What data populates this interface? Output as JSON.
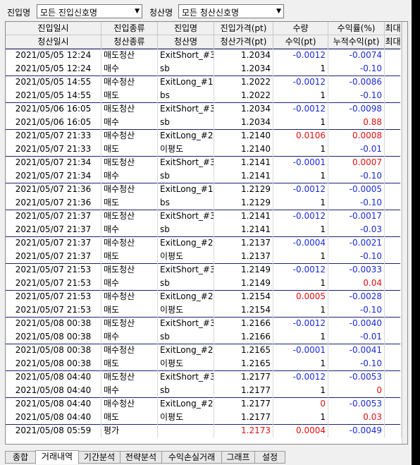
{
  "filters": {
    "entry_label": "진입명",
    "entry_value": "모든 진입신호명",
    "exit_label": "청산명",
    "exit_value": "모든 청산신호명"
  },
  "header": {
    "row1": [
      "진입일시",
      "진입종류",
      "진입명",
      "진입가격(pt)",
      "수량",
      "수익률(%)",
      "최대"
    ],
    "row2": [
      "청산일시",
      "청산종류",
      "청산명",
      "청산가격(pt)",
      "수익(pt)",
      "누적수익(pt)",
      "최대"
    ]
  },
  "rows": [
    {
      "d": "2021/05/05 12:24",
      "t": "매도청산",
      "n": "ExitShort_#3",
      "p": "1.2034",
      "q": "-0.0012",
      "r": "-0.0074",
      "qc": "blue",
      "rc": "blue",
      "entry": true
    },
    {
      "d": "2021/05/05 12:24",
      "t": "매수",
      "n": "sb",
      "p": "1.2034",
      "q": "1",
      "r": "-0.10",
      "qc": "",
      "rc": "blue",
      "entry": false
    },
    {
      "d": "2021/05/05 14:55",
      "t": "매수청산",
      "n": "ExitLong_#1",
      "p": "1.2022",
      "q": "-0.0012",
      "r": "-0.0086",
      "qc": "blue",
      "rc": "blue",
      "entry": true
    },
    {
      "d": "2021/05/05 14:55",
      "t": "매도",
      "n": "bs",
      "p": "1.2022",
      "q": "1",
      "r": "-0.10",
      "qc": "",
      "rc": "blue",
      "entry": false
    },
    {
      "d": "2021/05/06 16:05",
      "t": "매도청산",
      "n": "ExitShort_#3",
      "p": "1.2034",
      "q": "-0.0012",
      "r": "-0.0098",
      "qc": "blue",
      "rc": "blue",
      "entry": true
    },
    {
      "d": "2021/05/06 16:05",
      "t": "매수",
      "n": "sb",
      "p": "1.2034",
      "q": "1",
      "r": "0.88",
      "qc": "",
      "rc": "red",
      "entry": false
    },
    {
      "d": "2021/05/07 21:33",
      "t": "매수청산",
      "n": "ExitLong_#2",
      "p": "1.2140",
      "q": "0.0106",
      "r": "0.0008",
      "qc": "red",
      "rc": "red",
      "entry": true
    },
    {
      "d": "2021/05/07 21:33",
      "t": "매도",
      "n": "이평도",
      "p": "1.2140",
      "q": "1",
      "r": "-0.01",
      "qc": "",
      "rc": "blue",
      "entry": false
    },
    {
      "d": "2021/05/07 21:34",
      "t": "매도청산",
      "n": "ExitShort_#3",
      "p": "1.2141",
      "q": "-0.0001",
      "r": "0.0007",
      "qc": "blue",
      "rc": "red",
      "entry": true
    },
    {
      "d": "2021/05/07 21:34",
      "t": "매수",
      "n": "sb",
      "p": "1.2141",
      "q": "1",
      "r": "-0.10",
      "qc": "",
      "rc": "blue",
      "entry": false
    },
    {
      "d": "2021/05/07 21:36",
      "t": "매수청산",
      "n": "ExitLong_#1",
      "p": "1.2129",
      "q": "-0.0012",
      "r": "-0.0005",
      "qc": "blue",
      "rc": "blue",
      "entry": true
    },
    {
      "d": "2021/05/07 21:36",
      "t": "매도",
      "n": "bs",
      "p": "1.2129",
      "q": "1",
      "r": "-0.10",
      "qc": "",
      "rc": "blue",
      "entry": false
    },
    {
      "d": "2021/05/07 21:37",
      "t": "매도청산",
      "n": "ExitShort_#3",
      "p": "1.2141",
      "q": "-0.0012",
      "r": "-0.0017",
      "qc": "blue",
      "rc": "blue",
      "entry": true
    },
    {
      "d": "2021/05/07 21:37",
      "t": "매수",
      "n": "sb",
      "p": "1.2141",
      "q": "1",
      "r": "-0.03",
      "qc": "",
      "rc": "blue",
      "entry": false
    },
    {
      "d": "2021/05/07 21:37",
      "t": "매수청산",
      "n": "ExitLong_#2",
      "p": "1.2137",
      "q": "-0.0004",
      "r": "-0.0021",
      "qc": "blue",
      "rc": "blue",
      "entry": true
    },
    {
      "d": "2021/05/07 21:37",
      "t": "매도",
      "n": "이평도",
      "p": "1.2137",
      "q": "1",
      "r": "-0.10",
      "qc": "",
      "rc": "blue",
      "entry": false
    },
    {
      "d": "2021/05/07 21:53",
      "t": "매도청산",
      "n": "ExitShort_#3",
      "p": "1.2149",
      "q": "-0.0012",
      "r": "-0.0033",
      "qc": "blue",
      "rc": "blue",
      "entry": true
    },
    {
      "d": "2021/05/07 21:53",
      "t": "매수",
      "n": "sb",
      "p": "1.2149",
      "q": "1",
      "r": "0.04",
      "qc": "",
      "rc": "red",
      "entry": false
    },
    {
      "d": "2021/05/07 21:53",
      "t": "매수청산",
      "n": "ExitLong_#2",
      "p": "1.2154",
      "q": "0.0005",
      "r": "-0.0028",
      "qc": "red",
      "rc": "blue",
      "entry": true
    },
    {
      "d": "2021/05/07 21:53",
      "t": "매도",
      "n": "이평도",
      "p": "1.2154",
      "q": "1",
      "r": "-0.10",
      "qc": "",
      "rc": "blue",
      "entry": false
    },
    {
      "d": "2021/05/08 00:38",
      "t": "매도청산",
      "n": "ExitShort_#3",
      "p": "1.2166",
      "q": "-0.0012",
      "r": "-0.0040",
      "qc": "blue",
      "rc": "blue",
      "entry": true
    },
    {
      "d": "2021/05/08 00:38",
      "t": "매수",
      "n": "sb",
      "p": "1.2166",
      "q": "1",
      "r": "-0.01",
      "qc": "",
      "rc": "blue",
      "entry": false
    },
    {
      "d": "2021/05/08 00:38",
      "t": "매수청산",
      "n": "ExitLong_#2",
      "p": "1.2165",
      "q": "-0.0001",
      "r": "-0.0041",
      "qc": "blue",
      "rc": "blue",
      "entry": true
    },
    {
      "d": "2021/05/08 00:38",
      "t": "매도",
      "n": "이평도",
      "p": "1.2165",
      "q": "1",
      "r": "-0.10",
      "qc": "",
      "rc": "blue",
      "entry": false
    },
    {
      "d": "2021/05/08 04:40",
      "t": "매도청산",
      "n": "ExitShort_#3",
      "p": "1.2177",
      "q": "-0.0012",
      "r": "-0.0053",
      "qc": "blue",
      "rc": "blue",
      "entry": true
    },
    {
      "d": "2021/05/08 04:40",
      "t": "매수",
      "n": "sb",
      "p": "1.2177",
      "q": "1",
      "r": "0",
      "qc": "",
      "rc": "red",
      "entry": false
    },
    {
      "d": "2021/05/08 04:40",
      "t": "매수청산",
      "n": "ExitLong_#2",
      "p": "1.2177",
      "q": "0",
      "r": "-0.0053",
      "qc": "red",
      "rc": "blue",
      "entry": true
    },
    {
      "d": "2021/05/08 04:40",
      "t": "매도",
      "n": "이평도",
      "p": "1.2177",
      "q": "1",
      "r": "0.03",
      "qc": "",
      "rc": "red",
      "entry": false
    },
    {
      "d": "2021/05/08 05:59",
      "t": "평가",
      "n": "",
      "p": "1.2173",
      "q": "0.0004",
      "r": "-0.0049",
      "qc": "red",
      "rc": "blue",
      "pc": "red",
      "entry": true
    }
  ],
  "tabs": [
    "종합",
    "거래내역",
    "기간분석",
    "전략분석",
    "수익손실거래",
    "그래프",
    "설정"
  ],
  "active_tab": "거래내역",
  "colors": {
    "negative": "#1a2ad6",
    "positive": "#e01010",
    "row_separator": "#1a2470"
  }
}
